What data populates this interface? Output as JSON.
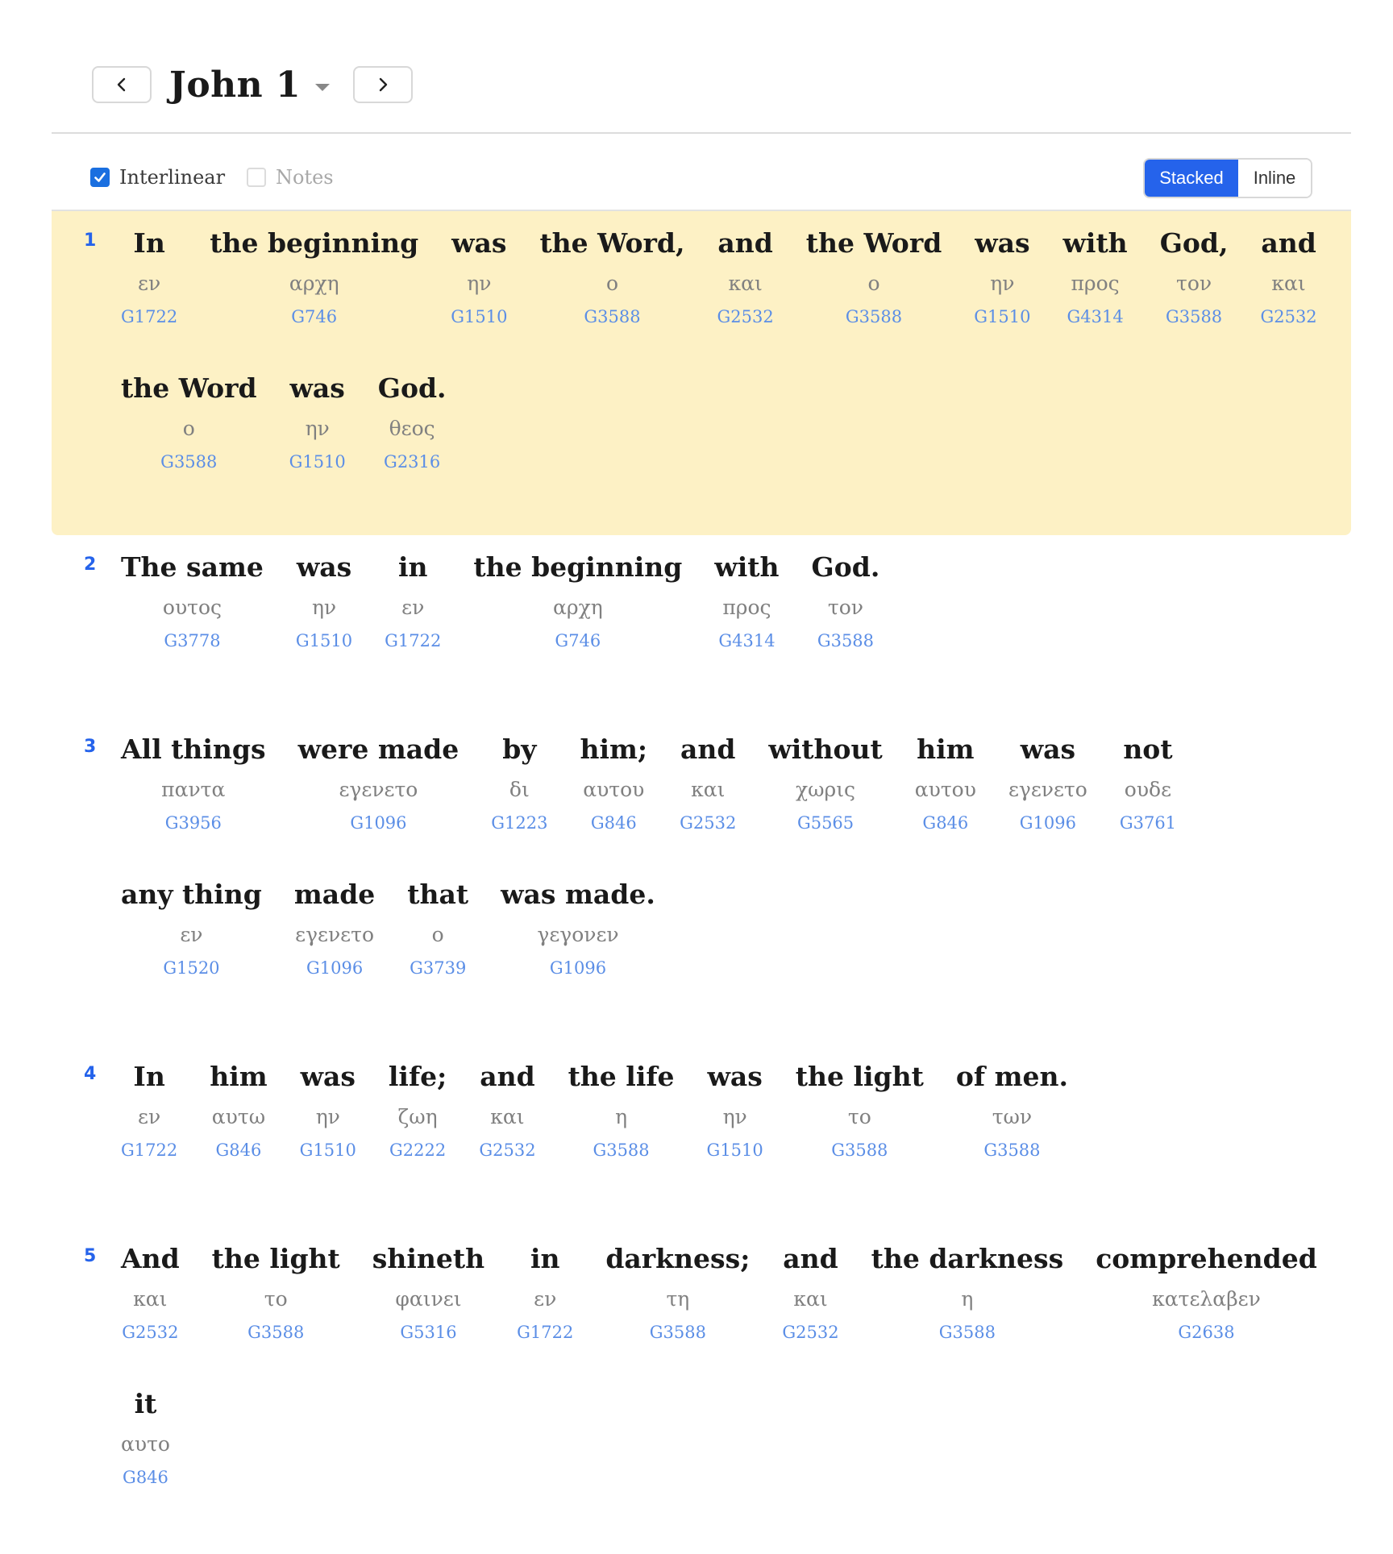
{
  "header": {
    "chapter_title": "John 1"
  },
  "options": {
    "interlinear_label": "Interlinear",
    "interlinear_checked": true,
    "notes_label": "Notes",
    "notes_checked": false,
    "view_modes": [
      "Stacked",
      "Inline"
    ],
    "active_view_mode": "Stacked"
  },
  "colors": {
    "accent": "#2563eb",
    "highlight": "#fdf1c5",
    "strongs_link": "#5b8ee6",
    "greek_text": "#808080"
  },
  "verses": [
    {
      "number": "1",
      "highlighted": true,
      "words": [
        {
          "en": "In",
          "gk": "εν",
          "num": "G1722"
        },
        {
          "en": "the beginning",
          "gk": "αρχη",
          "num": "G746"
        },
        {
          "en": "was",
          "gk": "ην",
          "num": "G1510"
        },
        {
          "en": "the Word,",
          "gk": "ο",
          "num": "G3588"
        },
        {
          "en": "and",
          "gk": "και",
          "num": "G2532"
        },
        {
          "en": "the Word",
          "gk": "ο",
          "num": "G3588"
        },
        {
          "en": "was",
          "gk": "ην",
          "num": "G1510"
        },
        {
          "en": "with",
          "gk": "προς",
          "num": "G4314"
        },
        {
          "en": "God,",
          "gk": "τον",
          "num": "G3588"
        },
        {
          "en": "and",
          "gk": "και",
          "num": "G2532"
        },
        {
          "en": "the Word",
          "gk": "ο",
          "num": "G3588"
        },
        {
          "en": "was",
          "gk": "ην",
          "num": "G1510"
        },
        {
          "en": "God.",
          "gk": "θεος",
          "num": "G2316"
        }
      ]
    },
    {
      "number": "2",
      "highlighted": false,
      "words": [
        {
          "en": "The same",
          "gk": "ουτος",
          "num": "G3778"
        },
        {
          "en": "was",
          "gk": "ην",
          "num": "G1510"
        },
        {
          "en": "in",
          "gk": "εν",
          "num": "G1722"
        },
        {
          "en": "the beginning",
          "gk": "αρχη",
          "num": "G746"
        },
        {
          "en": "with",
          "gk": "προς",
          "num": "G4314"
        },
        {
          "en": "God.",
          "gk": "τον",
          "num": "G3588"
        }
      ]
    },
    {
      "number": "3",
      "highlighted": false,
      "words": [
        {
          "en": "All things",
          "gk": "παντα",
          "num": "G3956"
        },
        {
          "en": "were made",
          "gk": "εγενετο",
          "num": "G1096"
        },
        {
          "en": "by",
          "gk": "δι",
          "num": "G1223"
        },
        {
          "en": "him;",
          "gk": "αυτου",
          "num": "G846"
        },
        {
          "en": "and",
          "gk": "και",
          "num": "G2532"
        },
        {
          "en": "without",
          "gk": "χωρις",
          "num": "G5565"
        },
        {
          "en": "him",
          "gk": "αυτου",
          "num": "G846"
        },
        {
          "en": "was",
          "gk": "εγενετο",
          "num": "G1096"
        },
        {
          "en": "not",
          "gk": "ουδε",
          "num": "G3761"
        },
        {
          "en": "any thing",
          "gk": "εν",
          "num": "G1520"
        },
        {
          "en": "made",
          "gk": "εγενετο",
          "num": "G1096"
        },
        {
          "en": "that",
          "gk": "ο",
          "num": "G3739"
        },
        {
          "en": "was made.",
          "gk": "γεγονεν",
          "num": "G1096"
        }
      ]
    },
    {
      "number": "4",
      "highlighted": false,
      "words": [
        {
          "en": "In",
          "gk": "εν",
          "num": "G1722"
        },
        {
          "en": "him",
          "gk": "αυτω",
          "num": "G846"
        },
        {
          "en": "was",
          "gk": "ην",
          "num": "G1510"
        },
        {
          "en": "life;",
          "gk": "ζωη",
          "num": "G2222"
        },
        {
          "en": "and",
          "gk": "και",
          "num": "G2532"
        },
        {
          "en": "the life",
          "gk": "η",
          "num": "G3588"
        },
        {
          "en": "was",
          "gk": "ην",
          "num": "G1510"
        },
        {
          "en": "the light",
          "gk": "το",
          "num": "G3588"
        },
        {
          "en": "of men.",
          "gk": "των",
          "num": "G3588"
        }
      ]
    },
    {
      "number": "5",
      "highlighted": false,
      "words": [
        {
          "en": "And",
          "gk": "και",
          "num": "G2532"
        },
        {
          "en": "the light",
          "gk": "το",
          "num": "G3588"
        },
        {
          "en": "shineth",
          "gk": "φαινει",
          "num": "G5316"
        },
        {
          "en": "in",
          "gk": "εν",
          "num": "G1722"
        },
        {
          "en": "darkness;",
          "gk": "τη",
          "num": "G3588"
        },
        {
          "en": "and",
          "gk": "και",
          "num": "G2532"
        },
        {
          "en": "the darkness",
          "gk": "η",
          "num": "G3588"
        },
        {
          "en": "comprehended",
          "gk": "κατελαβεν",
          "num": "G2638"
        },
        {
          "en": "it",
          "gk": "αυτο",
          "num": "G846"
        }
      ]
    }
  ]
}
